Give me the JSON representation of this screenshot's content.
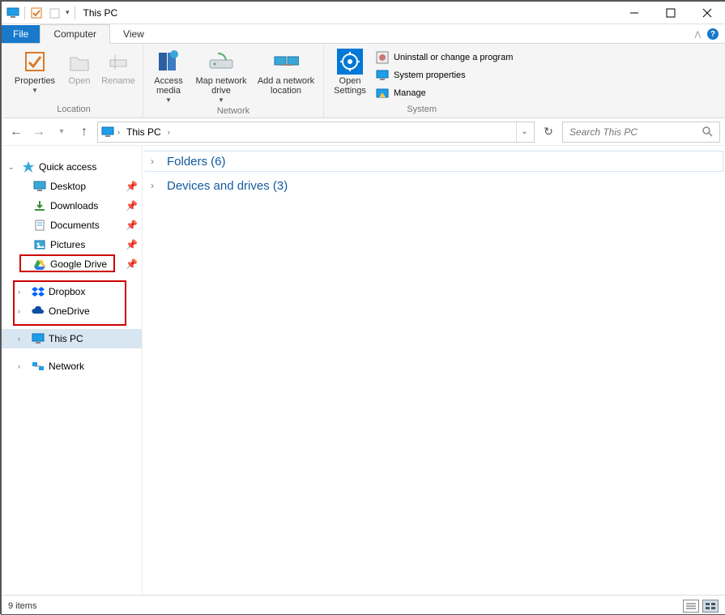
{
  "window": {
    "title": "This PC"
  },
  "tabs": {
    "file": "File",
    "computer": "Computer",
    "view": "View"
  },
  "ribbon": {
    "location": {
      "label": "Location",
      "properties": "Properties",
      "open": "Open",
      "rename": "Rename"
    },
    "network": {
      "label": "Network",
      "access_media": "Access media",
      "map_drive": "Map network drive",
      "add_location": "Add a network location"
    },
    "settings": {
      "open": "Open Settings"
    },
    "system": {
      "label": "System",
      "uninstall": "Uninstall or change a program",
      "sysprops": "System properties",
      "manage": "Manage"
    }
  },
  "address": {
    "crumb": "This PC"
  },
  "search": {
    "placeholder": "Search This PC"
  },
  "sidebar": {
    "quick_access": "Quick access",
    "desktop": "Desktop",
    "downloads": "Downloads",
    "documents": "Documents",
    "pictures": "Pictures",
    "google_drive": "Google Drive",
    "dropbox": "Dropbox",
    "onedrive": "OneDrive",
    "this_pc": "This PC",
    "network": "Network"
  },
  "groups": {
    "folders": "Folders (6)",
    "devices": "Devices and drives (3)"
  },
  "status": {
    "items": "9 items"
  }
}
